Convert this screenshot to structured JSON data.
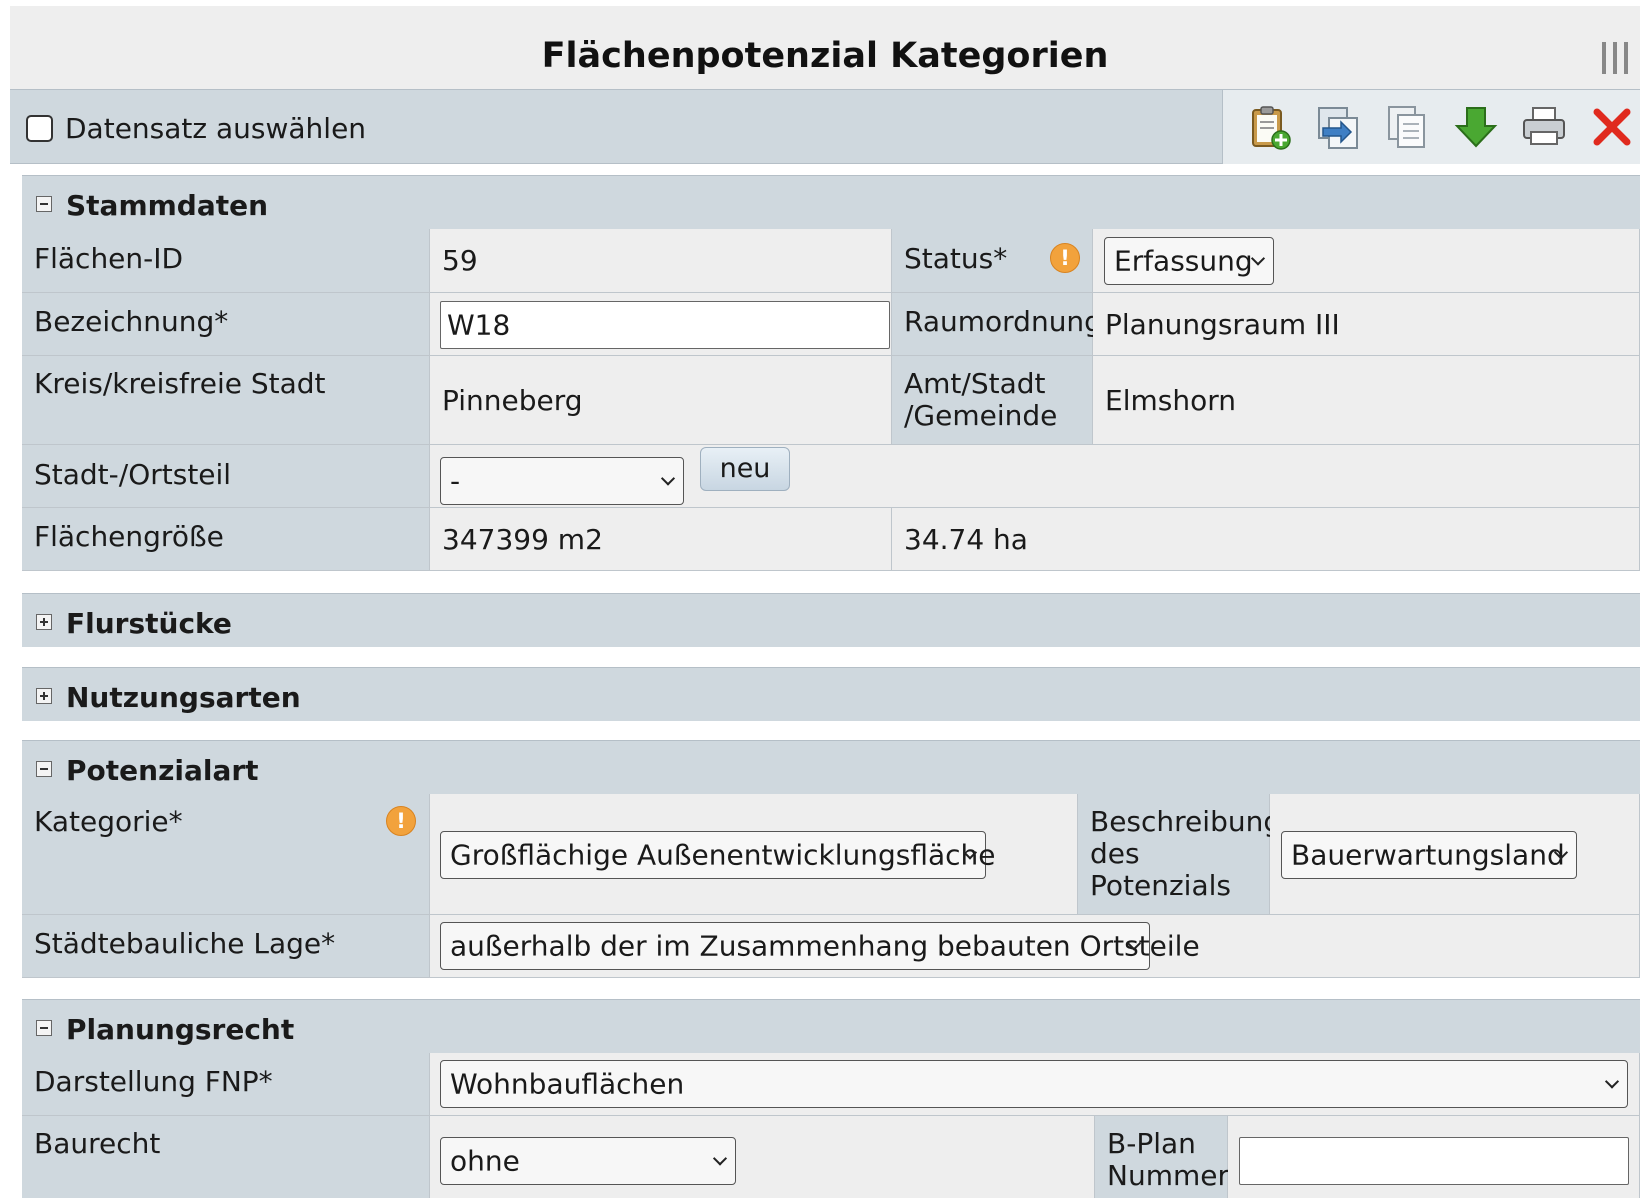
{
  "window": {
    "title": "Flächenpotenzial Kategorien",
    "menu_icon": "three-bars-icon"
  },
  "toolbar": {
    "select_all_label": "Datensatz auswählen",
    "icons": [
      "clipboard-add-icon",
      "import-icon",
      "copy-icon",
      "download-icon",
      "print-icon",
      "delete-icon"
    ]
  },
  "stammdaten": {
    "title": "Stammdaten",
    "flaechen_id_label": "Flächen-ID",
    "flaechen_id_value": "59",
    "status_label": "Status*",
    "status_value": "Erfassung",
    "bezeichnung_label": "Bezeichnung*",
    "bezeichnung_value": "W18",
    "raumordnung_label": "Raumordnung",
    "raumordnung_value": "Planungsraum III",
    "kreis_label": "Kreis/kreisfreie Stadt",
    "kreis_value": "Pinneberg",
    "amt_label_1": "Amt/Stadt",
    "amt_label_2": "/Gemeinde",
    "amt_value": "Elmshorn",
    "ortsteil_label": "Stadt-/Ortsteil",
    "ortsteil_value": "-",
    "neu_button": "neu",
    "groesse_label": "Flächengröße",
    "groesse_m2": "347399 m2",
    "groesse_ha": "34.74 ha"
  },
  "flurstuecke": {
    "title": "Flurstücke"
  },
  "nutzungsarten": {
    "title": "Nutzungsarten"
  },
  "potenzialart": {
    "title": "Potenzialart",
    "kategorie_label": "Kategorie*",
    "kategorie_value": "Großflächige Außenentwicklungsfläche",
    "beschreibung_label_1": "Beschreibung",
    "beschreibung_label_2": "des",
    "beschreibung_label_3": "Potenzials",
    "beschreibung_value": "Bauerwartungsland",
    "lage_label": "Städtebauliche Lage*",
    "lage_value": "außerhalb der im Zusammenhang bebauten Ortsteile"
  },
  "planungsrecht": {
    "title": "Planungsrecht",
    "fnp_label": "Darstellung FNP*",
    "fnp_value": "Wohnbauflächen",
    "baurecht_label": "Baurecht",
    "baurecht_value": "ohne",
    "bplan_label_1": "B-Plan",
    "bplan_label_2": "Nummer",
    "bplan_value": ""
  },
  "colors": {
    "header_bg": "#cfd8de",
    "value_bg": "#eeeeee",
    "warning": "#f2a23c",
    "delete": "#e02a1e",
    "download": "#4aa832"
  }
}
